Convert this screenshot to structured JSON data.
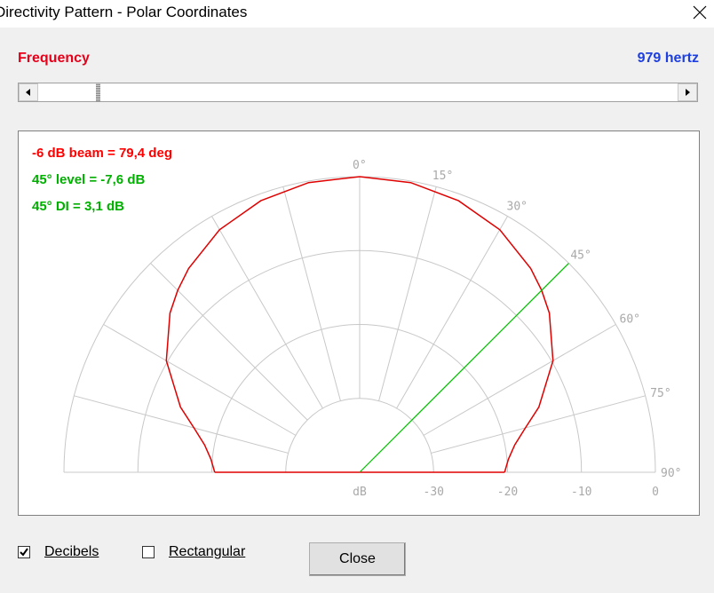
{
  "window": {
    "title": "Directivity Pattern - Polar Coordinates"
  },
  "frequency": {
    "label": "Frequency",
    "value_text": "979 hertz",
    "slider_fraction": 0.09
  },
  "stats": {
    "beam": "-6 dB beam = 79,4 deg",
    "level45": "45° level = -7,6 dB",
    "di45": "45° DI = 3,1 dB"
  },
  "chart_data": {
    "type": "polar",
    "angle_labels": [
      "0°",
      "15°",
      "30°",
      "45°",
      "60°",
      "75°",
      "90°"
    ],
    "radial_labels": [
      "dB",
      "-30",
      "-20",
      "-10",
      "0"
    ],
    "radial_rings_db": [
      -30,
      -20,
      -10,
      0
    ],
    "range_db": [
      -40,
      0
    ],
    "grid": true,
    "colors": {
      "grid": "#c8c8c8",
      "pattern": "#e00000",
      "marker": "#00c000",
      "labels": "#a9a9a9"
    },
    "pattern": {
      "angles_deg": [
        0,
        10,
        20,
        30,
        40,
        45,
        50,
        60,
        70,
        75,
        80,
        85,
        90
      ],
      "level_db": [
        0,
        -0.2,
        -0.9,
        -2.1,
        -4.0,
        -5.2,
        -6.5,
        -9.8,
        -14.2,
        -16.8,
        -18.7,
        -19.8,
        -20.4
      ]
    },
    "marker_angle_deg": 45
  },
  "options": {
    "decibels_label": "Decibels",
    "decibels_checked": true,
    "rectangular_label": "Rectangular",
    "rectangular_checked": false
  },
  "buttons": {
    "close_label": "Close"
  }
}
